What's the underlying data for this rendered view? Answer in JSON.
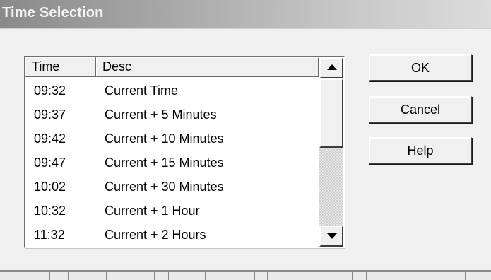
{
  "window": {
    "title": "Time Selection"
  },
  "list": {
    "columns": [
      "Time",
      "Desc"
    ],
    "rows": [
      {
        "time": "09:32",
        "desc": "Current Time"
      },
      {
        "time": "09:37",
        "desc": "Current + 5 Minutes"
      },
      {
        "time": "09:42",
        "desc": "Current + 10 Minutes"
      },
      {
        "time": "09:47",
        "desc": "Current + 15 Minutes"
      },
      {
        "time": "10:02",
        "desc": "Current + 30 Minutes"
      },
      {
        "time": "10:32",
        "desc": "Current + 1 Hour"
      },
      {
        "time": "11:32",
        "desc": "Current + 2 Hours"
      }
    ]
  },
  "buttons": {
    "ok": "OK",
    "cancel": "Cancel",
    "help": "Help"
  }
}
